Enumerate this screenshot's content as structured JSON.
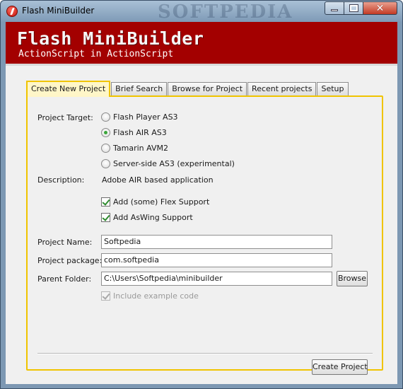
{
  "window": {
    "title": "Flash MiniBuilder",
    "watermark": "SOFTPEDIA"
  },
  "banner": {
    "title": "Flash MiniBuilder",
    "subtitle": "ActionScript in ActionScript",
    "color": "#a30000"
  },
  "tabs": [
    {
      "label": "Create New Project",
      "active": true
    },
    {
      "label": "Brief Search",
      "active": false
    },
    {
      "label": "Browse for Project",
      "active": false
    },
    {
      "label": "Recent projects",
      "active": false
    },
    {
      "label": "Setup",
      "active": false
    }
  ],
  "form": {
    "target_label": "Project Target:",
    "targets": [
      {
        "label": "Flash Player AS3",
        "selected": false
      },
      {
        "label": "Flash AIR AS3",
        "selected": true
      },
      {
        "label": "Tamarin AVM2",
        "selected": false
      },
      {
        "label": "Server-side AS3 (experimental)",
        "selected": false
      }
    ],
    "description_label": "Description:",
    "description_value": "Adobe AIR based application",
    "options": [
      {
        "label": "Add (some) Flex Support",
        "checked": true
      },
      {
        "label": "Add AsWing Support",
        "checked": true
      }
    ],
    "name_label": "Project Name:",
    "name_value": "Softpedia",
    "package_label": "Project package:",
    "package_value": "com.softpedia",
    "folder_label": "Parent Folder:",
    "folder_value": "C:\\Users\\Softpedia\\minibuilder",
    "browse_label": "Browse",
    "include_example_label": "Include example code",
    "include_example_checked": true,
    "include_example_disabled": true,
    "create_label": "Create Project"
  },
  "colors": {
    "active_tab_border": "#f0c400",
    "radio_selected": "#3aa53a",
    "checkmark": "#2e8b2e"
  }
}
